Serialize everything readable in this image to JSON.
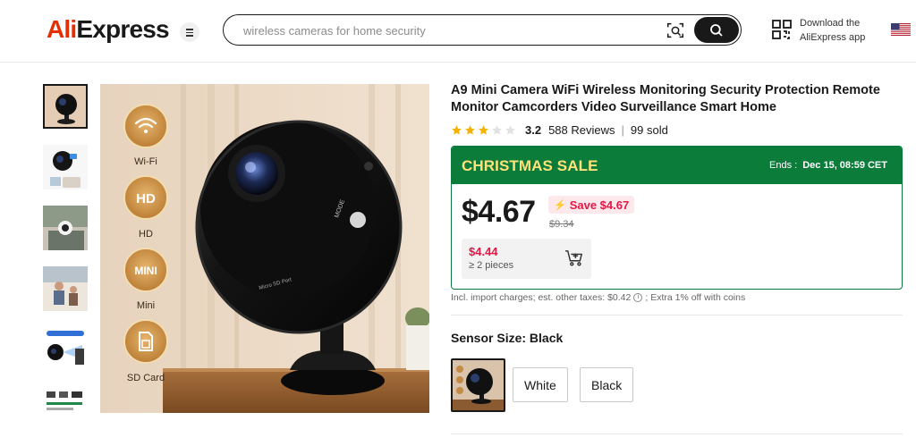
{
  "header": {
    "logo": {
      "prefix": "Ali",
      "suffix": "Express"
    },
    "search": {
      "value": "",
      "placeholder": "wireless cameras for home security"
    },
    "download": {
      "line1": "Download the",
      "line2": "AliExpress app"
    },
    "icons": [
      "menu-icon",
      "camera-search-icon",
      "search-icon",
      "qr-code-icon",
      "us-flag-icon"
    ]
  },
  "gallery": {
    "thumbnails": 6,
    "active_index": 0,
    "main_image_features": [
      {
        "label": "Wi-Fi",
        "icon": "wifi-icon"
      },
      {
        "label": "HD",
        "icon": "hd-icon"
      },
      {
        "label": "Mini",
        "icon": "mini-icon"
      },
      {
        "label": "SD Card",
        "icon": "sd-card-icon"
      }
    ],
    "badge_words": {
      "hd": "HD",
      "mini": "MINI"
    },
    "camera_text": {
      "mode": "MODE",
      "port": "Micro SD Port"
    }
  },
  "product": {
    "title": "A9 Mini Camera WiFi Wireless Monitoring Security Protection Remote Monitor Camcorders Video Surveillance Smart Home",
    "rating": {
      "value": "3.2",
      "stars_filled": 3,
      "stars_total": 5,
      "reviews": "588 Reviews",
      "sold": "99 sold"
    }
  },
  "deal": {
    "name": "CHRISTMAS SALE",
    "ends_label": "Ends :",
    "ends_value": "Dec 15, 08:59 CET",
    "price": "$4.67",
    "save": "Save $4.67",
    "original_price": "$9.34",
    "tier": {
      "price": "$4.44",
      "quantity": "≥ 2 pieces"
    },
    "colors": {
      "header_bg": "#0c7c3b",
      "header_text": "#ffe27a",
      "accent_red": "#e11846"
    }
  },
  "tax": {
    "text": "Incl. import charges; est. other taxes: $0.42",
    "extra": "; Extra 1% off with coins"
  },
  "variants": {
    "label": "Sensor Size: ",
    "selected": "Black",
    "options": [
      "White",
      "Black"
    ]
  }
}
